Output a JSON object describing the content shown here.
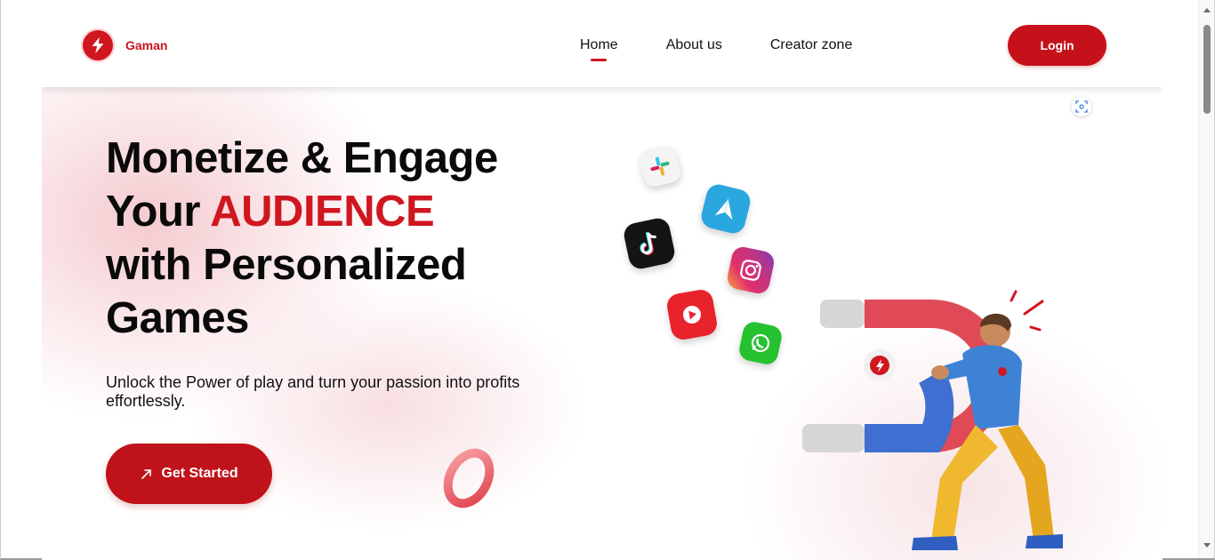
{
  "brand": {
    "name": "Gaman",
    "logo_icon": "lightning-bolt-icon",
    "color": "#d0161f"
  },
  "nav": {
    "links": [
      {
        "label": "Home",
        "active": true
      },
      {
        "label": "About us",
        "active": false
      },
      {
        "label": "Creator zone",
        "active": false
      }
    ],
    "login_label": "Login"
  },
  "hero": {
    "title_line1": "Monetize & Engage",
    "title_line2_prefix": "Your ",
    "title_line2_accent": "AUDIENCE",
    "title_line3": "with Personalized",
    "title_line4": "Games",
    "subtitle": "Unlock the Power of play and turn your passion into profits effortlessly.",
    "cta_label": "Get Started",
    "cta_icon": "arrow-up-right-icon"
  },
  "illustration": {
    "app_icons": [
      "slack-icon",
      "telegram-icon",
      "tiktok-icon",
      "instagram-icon",
      "youtube-icon",
      "whatsapp-icon"
    ],
    "figure": "man-with-magnet-illustration"
  },
  "colors": {
    "accent": "#d0161f",
    "text": "#0a0a0a",
    "button": "#c0121b"
  }
}
